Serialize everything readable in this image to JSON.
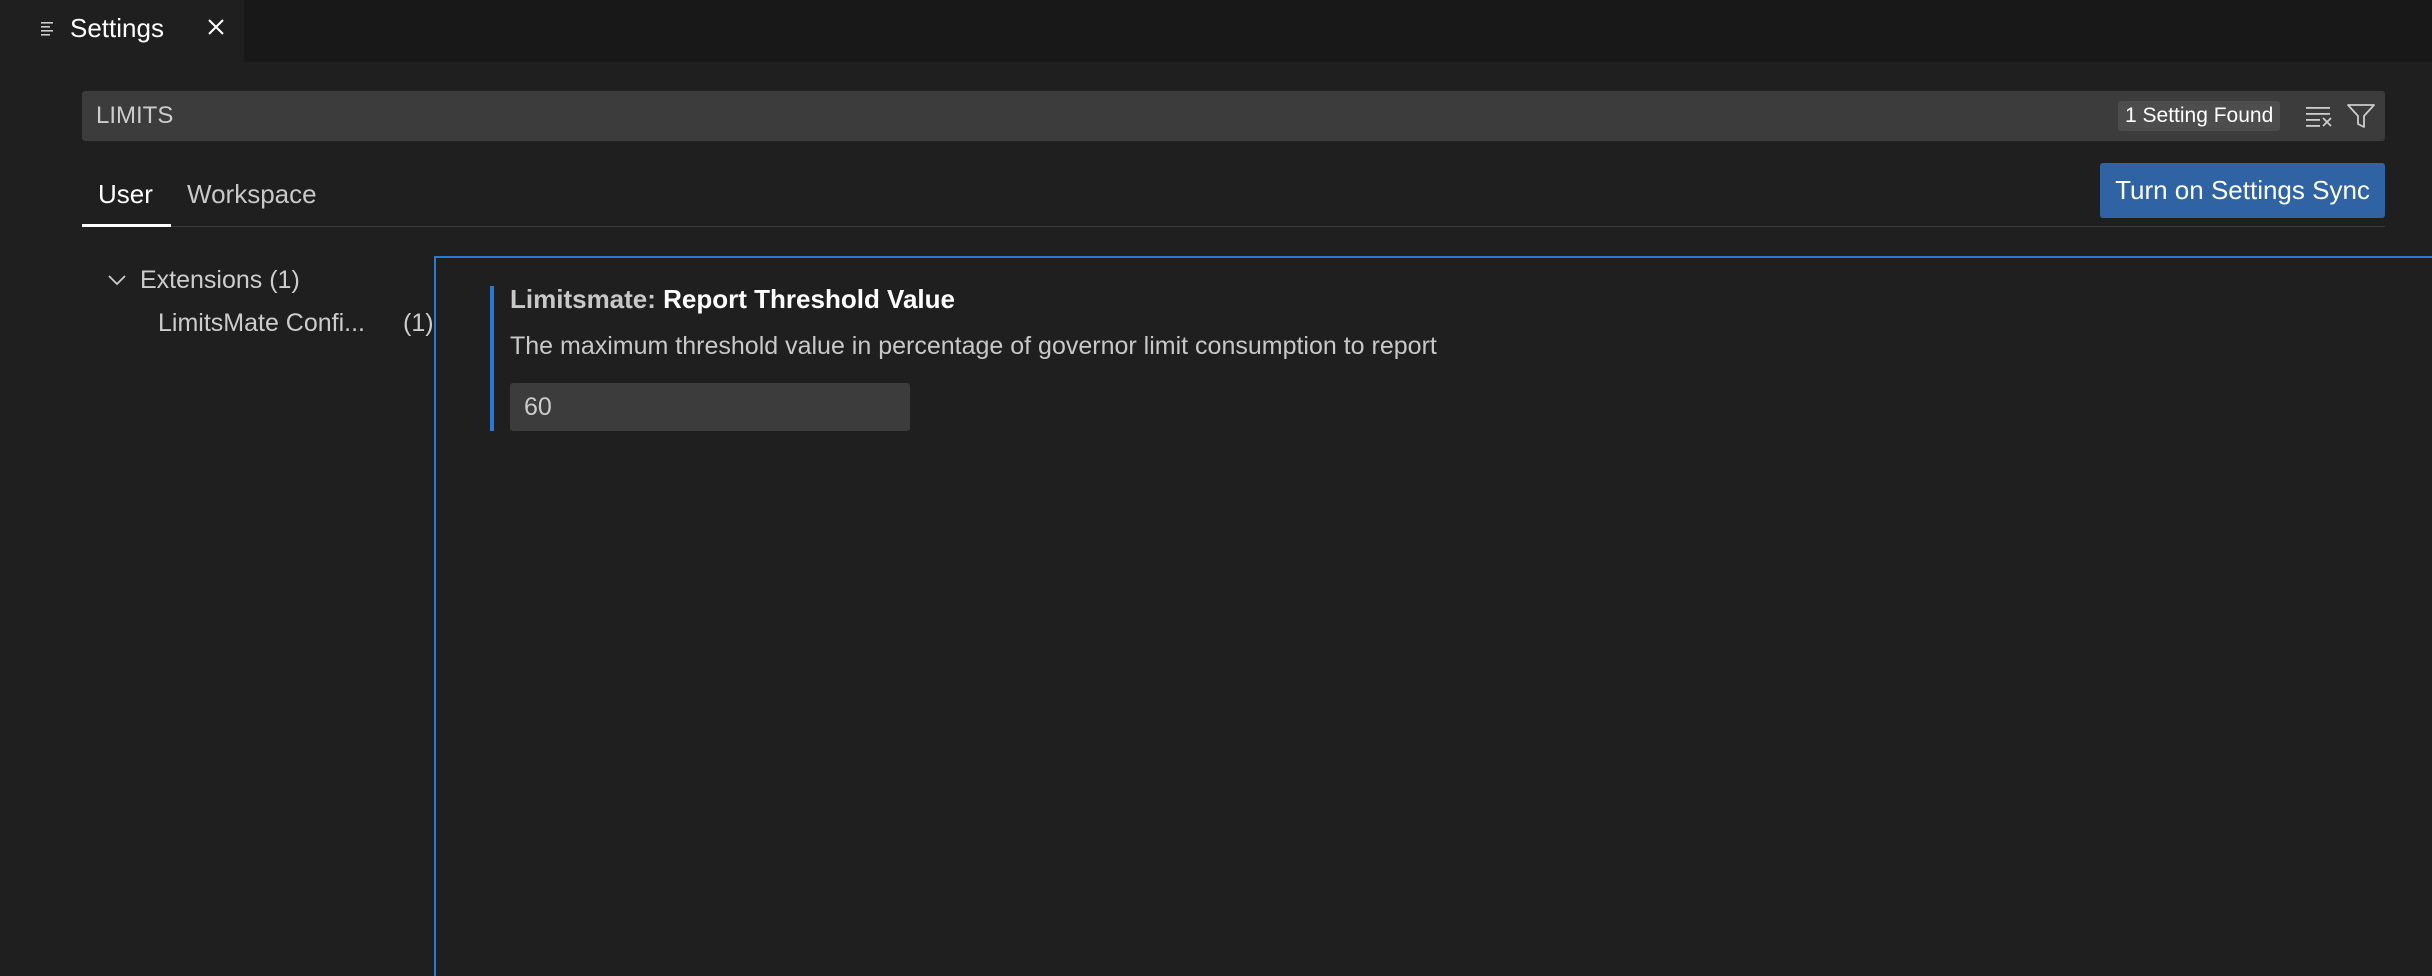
{
  "tab": {
    "title": "Settings",
    "icon": "settings-editor-icon",
    "close_icon": "close-icon"
  },
  "search": {
    "value": "LIMITS",
    "result_count": "1 Setting Found",
    "clear_icon": "clear-filter-icon",
    "filter_icon": "filter-icon"
  },
  "scopes": {
    "user": "User",
    "workspace": "Workspace",
    "active": "User"
  },
  "sync_button": "Turn on Settings Sync",
  "toc": {
    "group_label": "Extensions (1)",
    "item_label": "LimitsMate Confi...",
    "item_count": "(1)"
  },
  "setting": {
    "category": "Limitsmate: ",
    "name": "Report Threshold Value",
    "description": "The maximum threshold value in percentage of governor limit consumption to report",
    "value": "60"
  },
  "colors": {
    "accent": "#2b79d0",
    "button": "#2f63a4",
    "background": "#1f1f1f",
    "input_bg": "#3c3c3c"
  }
}
